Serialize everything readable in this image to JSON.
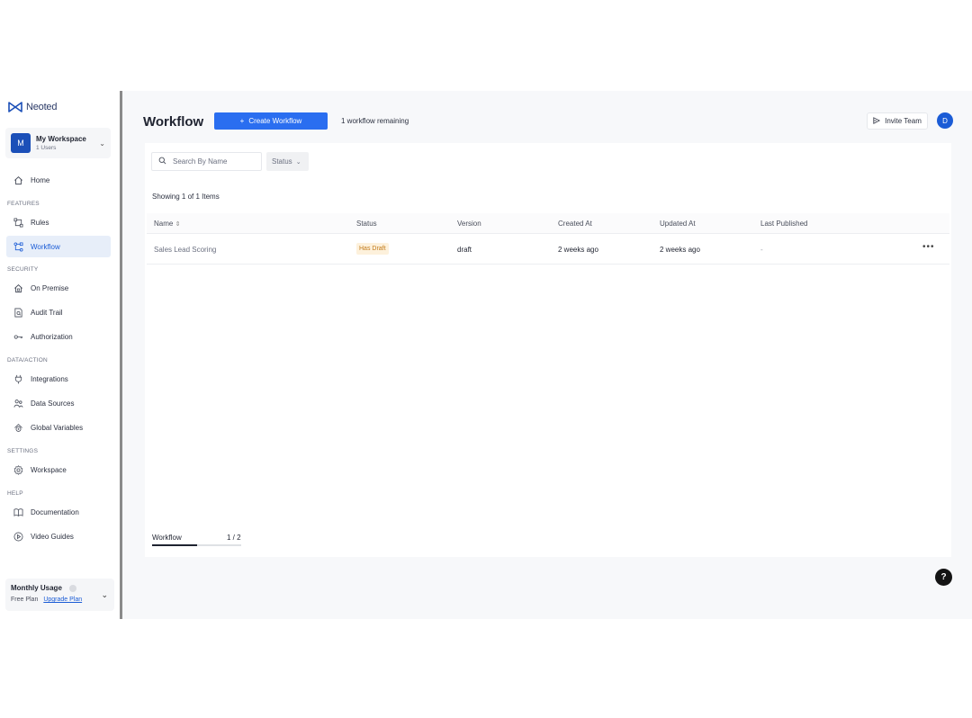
{
  "brand": {
    "name": "Neoted",
    "color": "#1b4fb8"
  },
  "workspace": {
    "initial": "M",
    "name": "My Workspace",
    "users": "1 Users"
  },
  "nav": {
    "home": "Home",
    "features_label": "FEATURES",
    "rules": "Rules",
    "workflow": "Workflow",
    "security_label": "SECURITY",
    "on_premise": "On Premise",
    "audit_trail": "Audit Trail",
    "authorization": "Authorization",
    "data_action_label": "DATA/ACTION",
    "integrations": "Integrations",
    "data_sources": "Data Sources",
    "global_variables": "Global Variables",
    "settings_label": "SETTINGS",
    "workspace": "Workspace",
    "help_label": "HELP",
    "documentation": "Documentation",
    "video_guides": "Video Guides"
  },
  "usage": {
    "title": "Monthly Usage",
    "plan": "Free Plan",
    "upgrade": "Upgrade Plan"
  },
  "header": {
    "title": "Workflow",
    "create_button": "Create Workflow",
    "remaining": "1 workflow remaining",
    "invite_button": "Invite Team",
    "user_initial": "D"
  },
  "filters": {
    "search_placeholder": "Search By Name",
    "status_label": "Status"
  },
  "table": {
    "showing": "Showing 1 of 1 Items",
    "columns": [
      "Name",
      "Status",
      "Version",
      "Created At",
      "Updated At",
      "Last Published"
    ],
    "rows": [
      {
        "name": "Sales Lead Scoring",
        "status": "Has Draft",
        "version": "draft",
        "created_at": "2 weeks ago",
        "updated_at": "2 weeks ago",
        "last_published": "-"
      }
    ]
  },
  "pager": {
    "label": "Workflow",
    "count": "1 / 2",
    "progress": 0.5
  },
  "colors": {
    "accent": "#2a6ef0",
    "active_nav_bg": "#e7eef9",
    "draft_badge_bg": "#fdf1dc",
    "draft_badge_text": "#c27a1a"
  }
}
